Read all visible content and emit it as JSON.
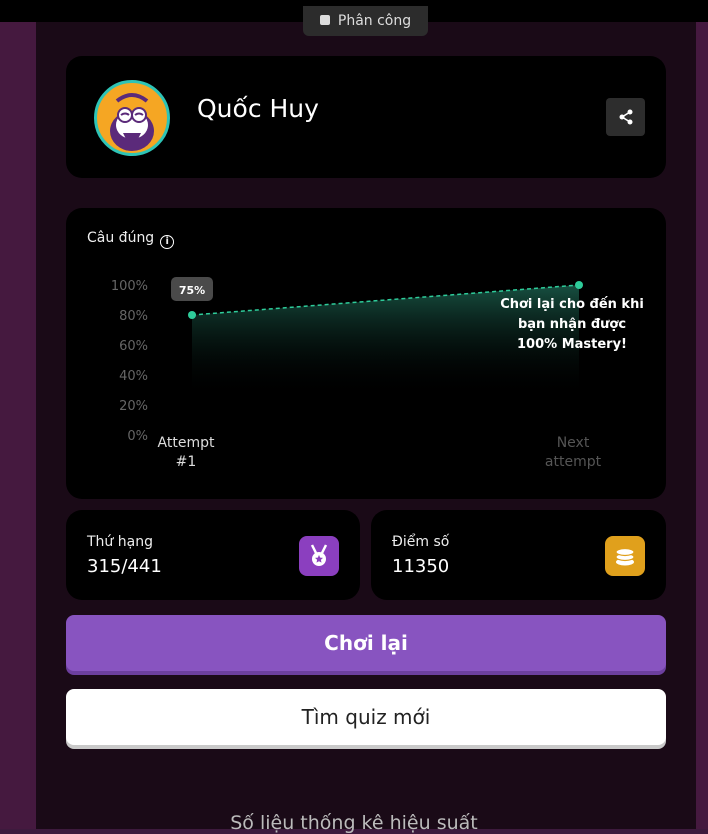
{
  "top_tag": {
    "label": "Phân công"
  },
  "profile": {
    "name": "Quốc Huy"
  },
  "chart_card": {
    "title": "Câu đúng"
  },
  "chart_data": {
    "type": "area",
    "title": "Câu đúng",
    "categories": [
      "Attempt #1",
      "Next attempt"
    ],
    "values": [
      80,
      100
    ],
    "current_label": "75%",
    "yticks": [
      "100%",
      "80%",
      "60%",
      "40%",
      "20%",
      "0%"
    ],
    "ylim": [
      0,
      100
    ],
    "xlabels": [
      [
        "Attempt",
        "#1"
      ],
      [
        "Next",
        "attempt"
      ]
    ],
    "annotation": [
      "Chơi lại cho đến khi",
      "bạn nhận được",
      "100% Mastery!"
    ],
    "colors": {
      "line": "#2ecc9a",
      "tag_bg": "#4a4a4a"
    }
  },
  "stats": {
    "rank": {
      "label": "Thứ hạng",
      "value": "315/441"
    },
    "score": {
      "label": "Điểm số",
      "value": "11350"
    }
  },
  "buttons": {
    "play_again": "Chơi lại",
    "find_quiz": "Tìm quiz mới"
  },
  "footer": {
    "heading": "Số liệu thống kê hiệu suất"
  },
  "colors": {
    "accent": "#8854c0",
    "coin": "#e0a01c",
    "medal": "#8b3fbf"
  }
}
